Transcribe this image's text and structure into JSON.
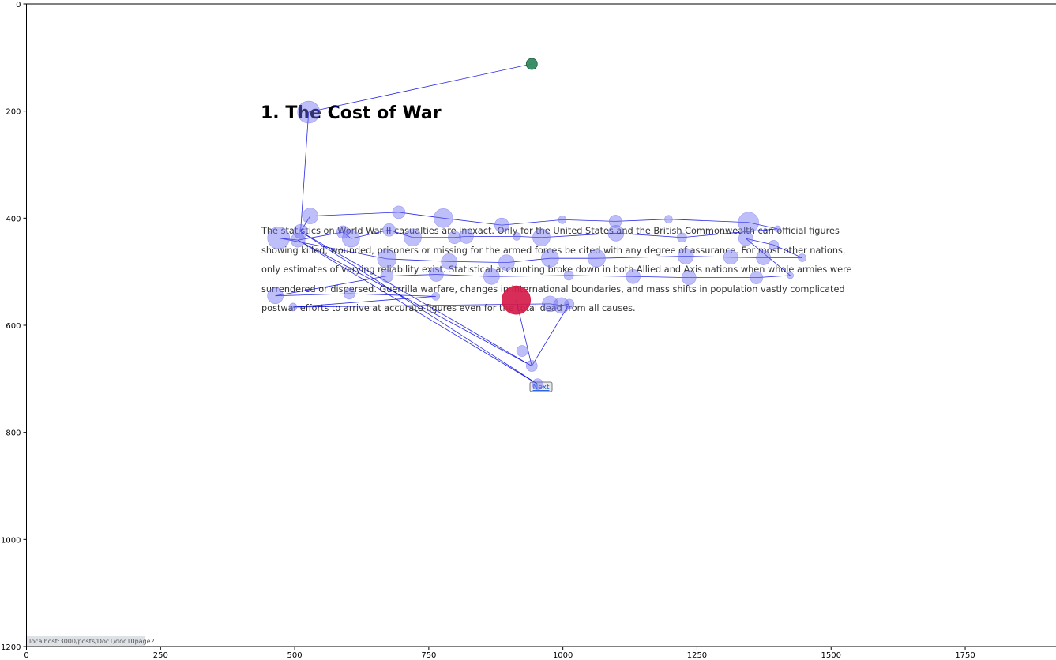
{
  "page": {
    "title": "1. The Cost of War",
    "paragraph_lines": [
      "The statistics on World War II casualties are inexact. Only for the United States and the British Commonwealth can official figures",
      "showing killed, wounded, prisoners or missing for the armed forces be cited with any degree of assurance. For most other nations,",
      "only estimates of varying reliability exist. Statistical accounting broke down in both Allied and Axis nations when whole armies were",
      "surrendered or dispersed. Guerrilla warfare, changes in international boundaries, and mass shifts in population vastly complicated",
      "postwar efforts to arrive at accurate figures even for the total dead from all causes."
    ],
    "next_button": "Next",
    "status_url": "localhost:3000/posts/Doc1/doc10page2"
  },
  "colors": {
    "fixation_fill": "#6e6ef0",
    "scanpath_line": "#0000dd",
    "start_point": "#2e8b57",
    "end_point": "#dc143c"
  },
  "chart_data": {
    "type": "scatter",
    "title": "",
    "xlabel": "",
    "ylabel": "",
    "xlim": [
      0,
      1920
    ],
    "ylim": [
      1200,
      0
    ],
    "y_inverted": true,
    "xticks": [
      0,
      250,
      500,
      750,
      1000,
      1250,
      1500,
      1750
    ],
    "yticks": [
      0,
      200,
      400,
      600,
      800,
      1000,
      1200
    ],
    "start": {
      "x": 942,
      "y": 112
    },
    "end": {
      "x": 913,
      "y": 553
    },
    "fixations": [
      {
        "x": 942,
        "y": 112,
        "r": 7
      },
      {
        "x": 526,
        "y": 202,
        "r": 14
      },
      {
        "x": 511,
        "y": 425,
        "r": 9
      },
      {
        "x": 529,
        "y": 396,
        "r": 10
      },
      {
        "x": 694,
        "y": 389,
        "r": 8
      },
      {
        "x": 777,
        "y": 400,
        "r": 12
      },
      {
        "x": 886,
        "y": 413,
        "r": 9
      },
      {
        "x": 999,
        "y": 403,
        "r": 5
      },
      {
        "x": 1098,
        "y": 406,
        "r": 8
      },
      {
        "x": 1197,
        "y": 402,
        "r": 5
      },
      {
        "x": 1346,
        "y": 408,
        "r": 13
      },
      {
        "x": 1400,
        "y": 420,
        "r": 4
      },
      {
        "x": 470,
        "y": 437,
        "r": 14
      },
      {
        "x": 506,
        "y": 441,
        "r": 9
      },
      {
        "x": 590,
        "y": 426,
        "r": 8
      },
      {
        "x": 605,
        "y": 438,
        "r": 11
      },
      {
        "x": 676,
        "y": 422,
        "r": 8
      },
      {
        "x": 720,
        "y": 436,
        "r": 11
      },
      {
        "x": 798,
        "y": 436,
        "r": 8
      },
      {
        "x": 820,
        "y": 434,
        "r": 9
      },
      {
        "x": 914,
        "y": 434,
        "r": 5
      },
      {
        "x": 960,
        "y": 436,
        "r": 11
      },
      {
        "x": 1099,
        "y": 428,
        "r": 10
      },
      {
        "x": 1222,
        "y": 436,
        "r": 6
      },
      {
        "x": 1341,
        "y": 438,
        "r": 9
      },
      {
        "x": 1393,
        "y": 450,
        "r": 6
      },
      {
        "x": 672,
        "y": 476,
        "r": 12
      },
      {
        "x": 788,
        "y": 481,
        "r": 10
      },
      {
        "x": 895,
        "y": 483,
        "r": 10
      },
      {
        "x": 976,
        "y": 475,
        "r": 11
      },
      {
        "x": 1063,
        "y": 475,
        "r": 11
      },
      {
        "x": 1229,
        "y": 471,
        "r": 10
      },
      {
        "x": 1313,
        "y": 473,
        "r": 9
      },
      {
        "x": 1374,
        "y": 474,
        "r": 9
      },
      {
        "x": 1446,
        "y": 474,
        "r": 5
      },
      {
        "x": 672,
        "y": 508,
        "r": 8
      },
      {
        "x": 764,
        "y": 505,
        "r": 9
      },
      {
        "x": 867,
        "y": 509,
        "r": 10
      },
      {
        "x": 1011,
        "y": 507,
        "r": 6
      },
      {
        "x": 1131,
        "y": 509,
        "r": 9
      },
      {
        "x": 1235,
        "y": 511,
        "r": 9
      },
      {
        "x": 1361,
        "y": 511,
        "r": 8
      },
      {
        "x": 1424,
        "y": 507,
        "r": 4
      },
      {
        "x": 464,
        "y": 545,
        "r": 10
      },
      {
        "x": 602,
        "y": 541,
        "r": 7
      },
      {
        "x": 763,
        "y": 546,
        "r": 5
      },
      {
        "x": 497,
        "y": 566,
        "r": 5
      },
      {
        "x": 913,
        "y": 553,
        "r": 18
      },
      {
        "x": 976,
        "y": 560,
        "r": 10
      },
      {
        "x": 997,
        "y": 563,
        "r": 10
      },
      {
        "x": 1012,
        "y": 560,
        "r": 6
      },
      {
        "x": 924,
        "y": 648,
        "r": 7
      },
      {
        "x": 942,
        "y": 676,
        "r": 7
      },
      {
        "x": 953,
        "y": 710,
        "r": 7
      }
    ],
    "scanpath": [
      {
        "x": 942,
        "y": 112
      },
      {
        "x": 526,
        "y": 202
      },
      {
        "x": 511,
        "y": 425
      },
      {
        "x": 953,
        "y": 710
      },
      {
        "x": 506,
        "y": 441
      },
      {
        "x": 942,
        "y": 676
      },
      {
        "x": 511,
        "y": 425
      },
      {
        "x": 529,
        "y": 396
      },
      {
        "x": 694,
        "y": 389
      },
      {
        "x": 777,
        "y": 400
      },
      {
        "x": 886,
        "y": 413
      },
      {
        "x": 999,
        "y": 403
      },
      {
        "x": 1098,
        "y": 406
      },
      {
        "x": 1197,
        "y": 402
      },
      {
        "x": 1346,
        "y": 408
      },
      {
        "x": 1400,
        "y": 420
      },
      {
        "x": 1222,
        "y": 436
      },
      {
        "x": 1099,
        "y": 428
      },
      {
        "x": 960,
        "y": 436
      },
      {
        "x": 914,
        "y": 434
      },
      {
        "x": 820,
        "y": 434
      },
      {
        "x": 798,
        "y": 436
      },
      {
        "x": 720,
        "y": 436
      },
      {
        "x": 676,
        "y": 422
      },
      {
        "x": 605,
        "y": 438
      },
      {
        "x": 590,
        "y": 426
      },
      {
        "x": 506,
        "y": 441
      },
      {
        "x": 470,
        "y": 437
      },
      {
        "x": 672,
        "y": 476
      },
      {
        "x": 788,
        "y": 481
      },
      {
        "x": 895,
        "y": 483
      },
      {
        "x": 976,
        "y": 475
      },
      {
        "x": 1063,
        "y": 475
      },
      {
        "x": 1229,
        "y": 471
      },
      {
        "x": 1313,
        "y": 473
      },
      {
        "x": 1374,
        "y": 474
      },
      {
        "x": 1446,
        "y": 474
      },
      {
        "x": 1393,
        "y": 450
      },
      {
        "x": 1341,
        "y": 438
      },
      {
        "x": 1424,
        "y": 507
      },
      {
        "x": 1361,
        "y": 511
      },
      {
        "x": 1235,
        "y": 511
      },
      {
        "x": 1131,
        "y": 509
      },
      {
        "x": 1011,
        "y": 507
      },
      {
        "x": 867,
        "y": 509
      },
      {
        "x": 764,
        "y": 505
      },
      {
        "x": 672,
        "y": 508
      },
      {
        "x": 464,
        "y": 545
      },
      {
        "x": 602,
        "y": 541
      },
      {
        "x": 763,
        "y": 546
      },
      {
        "x": 497,
        "y": 566
      },
      {
        "x": 976,
        "y": 560
      },
      {
        "x": 997,
        "y": 563
      },
      {
        "x": 1012,
        "y": 560
      },
      {
        "x": 942,
        "y": 676
      },
      {
        "x": 913,
        "y": 553
      }
    ]
  }
}
